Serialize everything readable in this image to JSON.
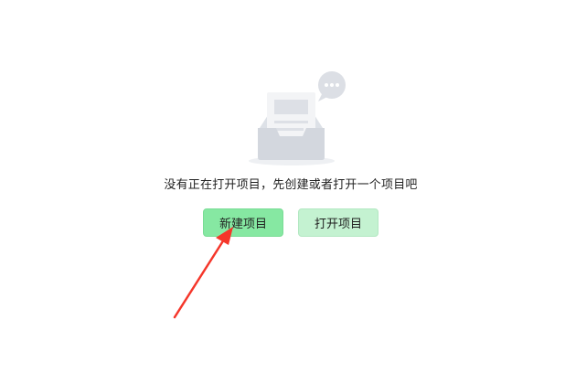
{
  "empty_state": {
    "message": "没有正在打开项目，先创建或者打开一个项目吧",
    "illustration_icon": "empty-inbox-icon",
    "bubble_icon": "chat-bubble-icon"
  },
  "actions": {
    "new_project_label": "新建项目",
    "open_project_label": "打开项目"
  },
  "colors": {
    "primary_button": "#86e8a2",
    "secondary_button": "#c4f2d1",
    "annotation_arrow": "#f5362a"
  }
}
